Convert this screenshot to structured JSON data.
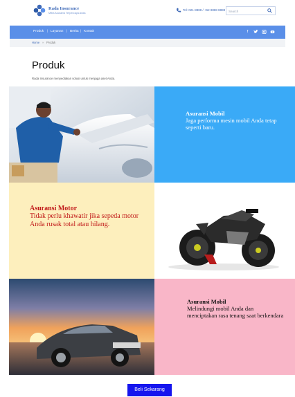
{
  "header": {
    "brand_name": "Rada Insurance",
    "brand_tagline": "Mitra Asuransi Terpercaya Anda",
    "phone": "Tel: 021-8888 / +62 8888 8888",
    "search_placeholder": "Search"
  },
  "nav": {
    "items": [
      {
        "label": "Produk"
      },
      {
        "label": "Layanan"
      },
      {
        "label": "Berita"
      },
      {
        "label": "Kontak"
      }
    ],
    "social": [
      "f",
      "t",
      "ig",
      "yt"
    ]
  },
  "breadcrumb": {
    "home": "Home",
    "separator": "»",
    "current": "Produk"
  },
  "page": {
    "title": "Produk",
    "description": "Rada Insurance menyediakan solusi untuk menjaga aset Anda."
  },
  "products": [
    {
      "title": "Asuransi Mobil",
      "text": "Jaga performa mesin mobil Anda tetap seperti baru."
    },
    {
      "title": "Asuransi Motor",
      "text": "Tidak perlu khawatir jika sepeda motor Anda rusak total atau hilang."
    },
    {
      "title": "Asuransi Mobil",
      "text": "Melindungi mobil Anda dan menciptakan rasa tenang saat berkendara"
    }
  ],
  "cta": {
    "label": "Beli Sekarang"
  },
  "colors": {
    "nav": "#5a8fe8",
    "tile_blue": "#3aaaf7",
    "tile_yellow": "#fdefbd",
    "tile_pink": "#f9b6c8",
    "cta": "#1515ee",
    "motor_text": "#c11a1a"
  }
}
